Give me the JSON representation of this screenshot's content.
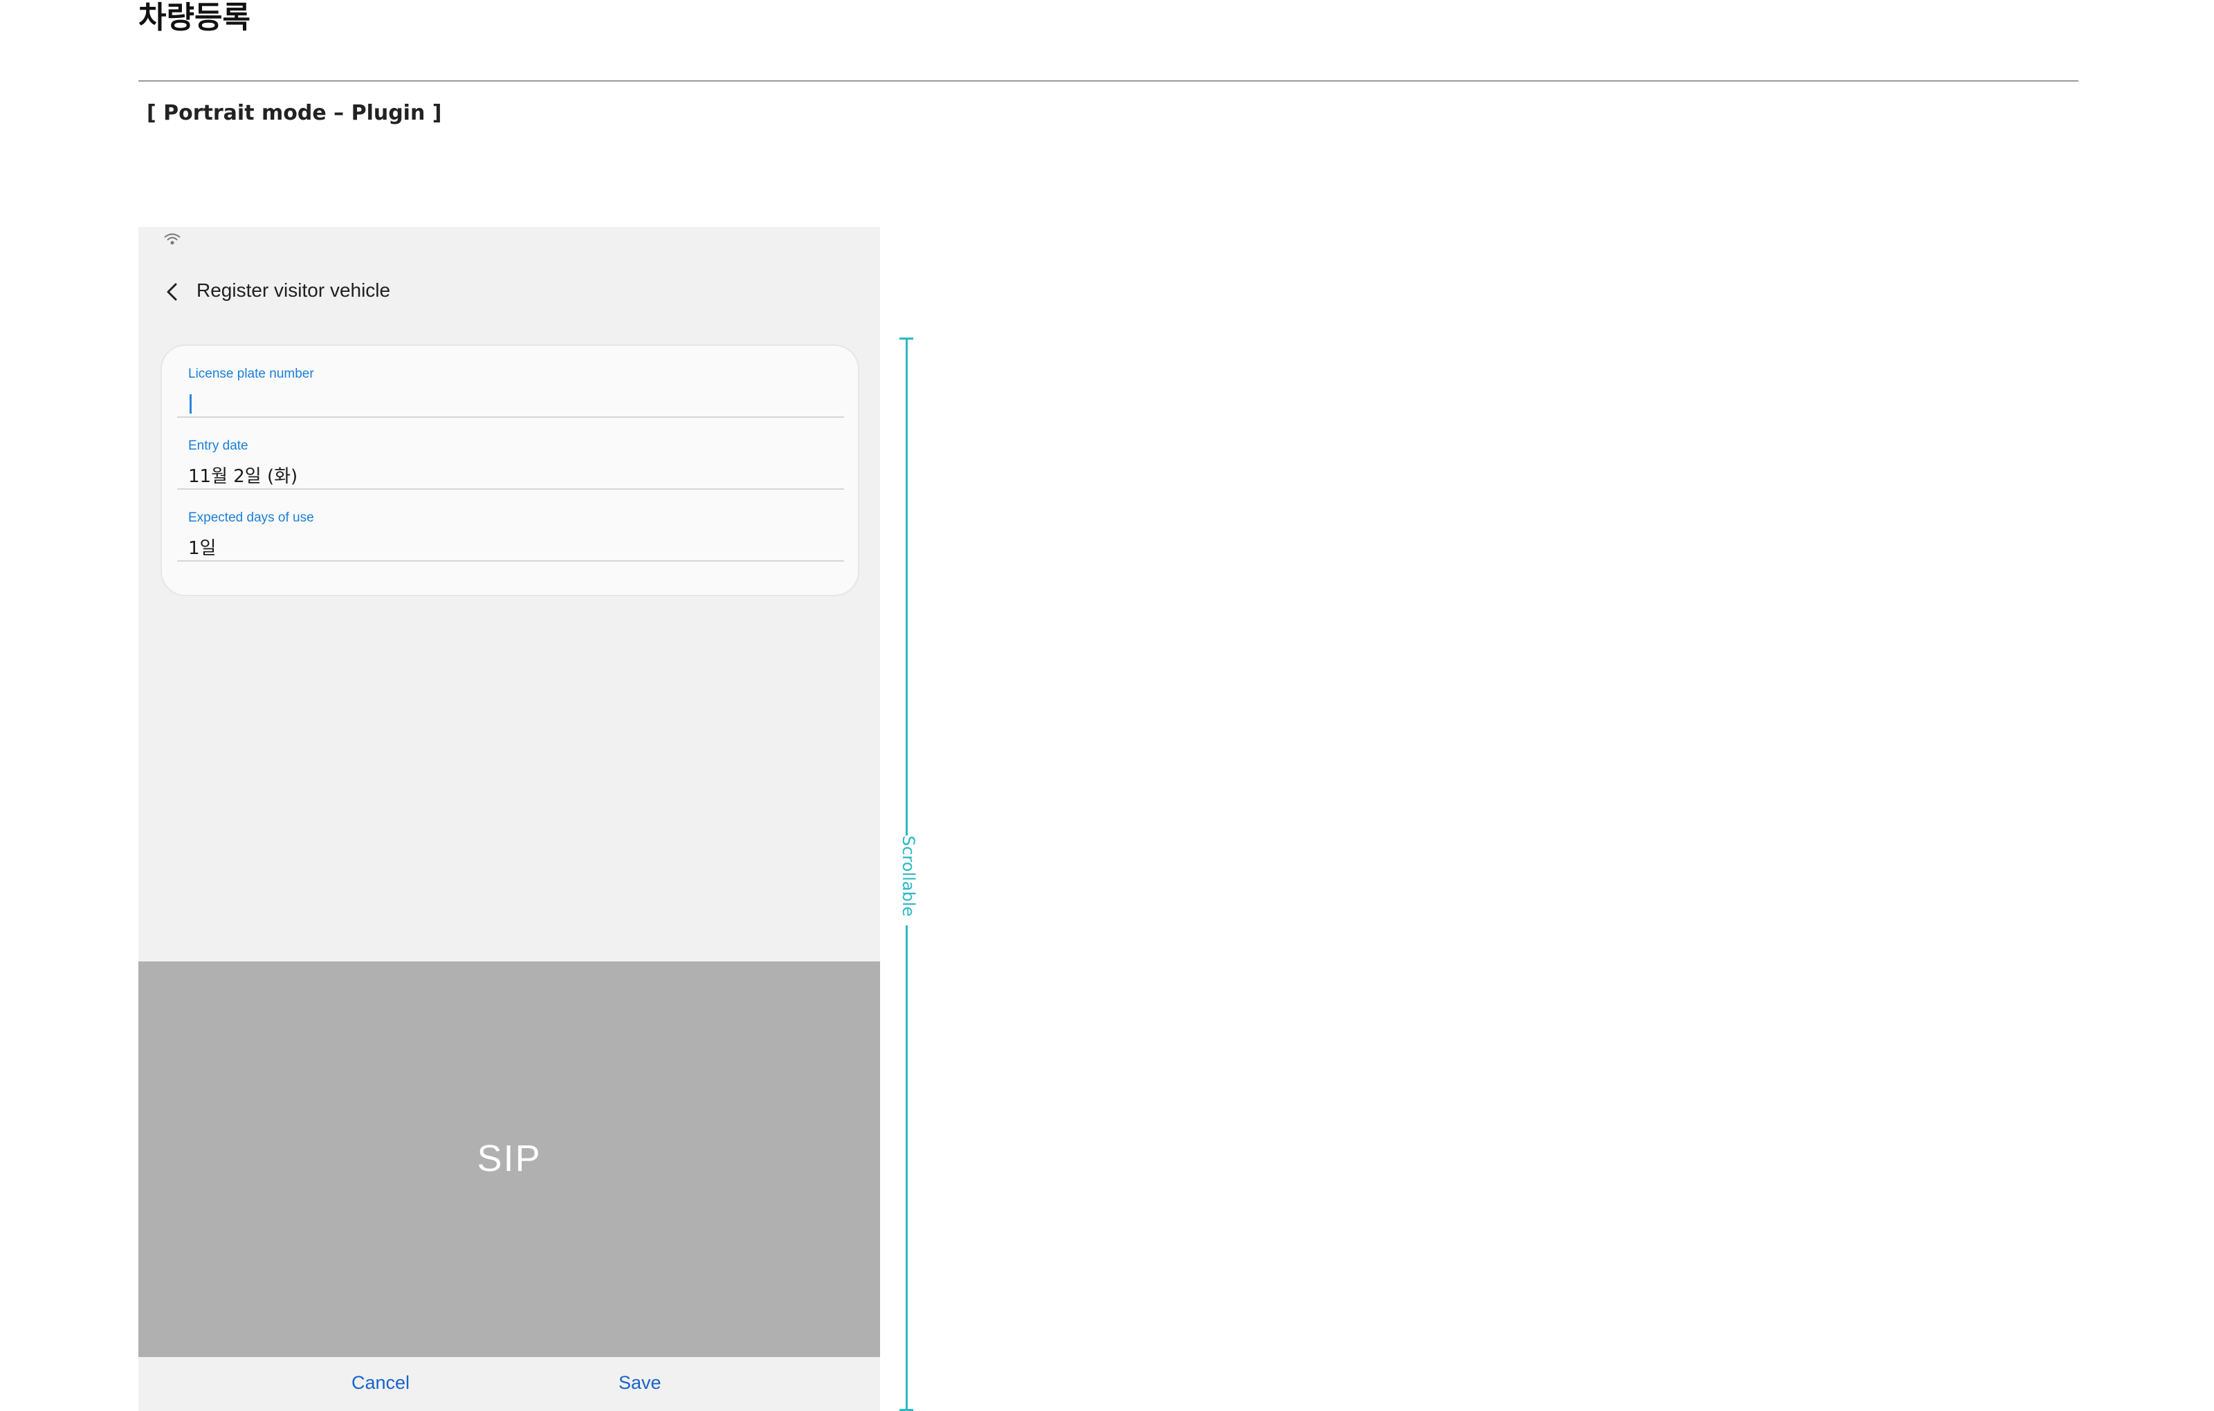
{
  "document": {
    "title": "차량등록",
    "subtitle": "[ Portrait mode – Plugin ]"
  },
  "phone": {
    "status_icons": [
      "wifi-icon"
    ],
    "app_bar": {
      "back_icon": "chevron-left-icon",
      "title": "Register visitor vehicle"
    },
    "form": {
      "fields": [
        {
          "label": "License plate number",
          "value": ""
        },
        {
          "label": "Entry date",
          "value": "11월 2일 (화)"
        },
        {
          "label": "Expected days of use",
          "value": "1일"
        }
      ]
    },
    "sip": {
      "label": "SIP"
    },
    "bottom_bar": {
      "cancel_label": "Cancel",
      "save_label": "Save"
    }
  },
  "annotation": {
    "scroll_label": "Scrollable"
  },
  "colors": {
    "accent_blue": "#1a7fd8",
    "button_blue": "#1a63c9",
    "annotation_teal": "#2bb8c4",
    "sip_gray": "#b0b0b0",
    "phone_bg": "#f1f1f1"
  }
}
